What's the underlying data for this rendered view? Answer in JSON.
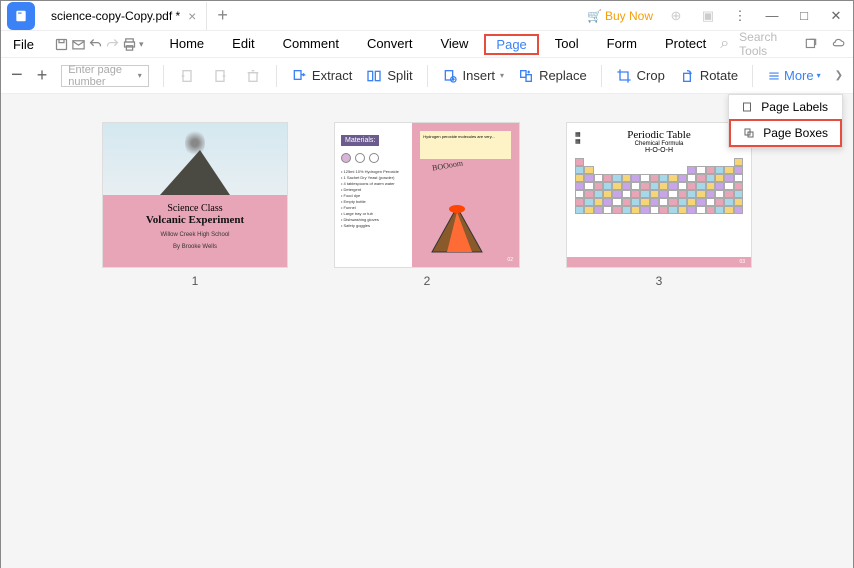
{
  "titlebar": {
    "tab_name": "science-copy-Copy.pdf *",
    "buy_now": "Buy Now"
  },
  "menubar": {
    "file": "File",
    "items": [
      "Home",
      "Edit",
      "Comment",
      "Convert",
      "View",
      "Page",
      "Tool",
      "Form",
      "Protect"
    ],
    "active_index": 5,
    "search_placeholder": "Search Tools"
  },
  "toolbar": {
    "page_input_placeholder": "Enter page number",
    "extract": "Extract",
    "split": "Split",
    "insert": "Insert",
    "replace": "Replace",
    "crop": "Crop",
    "rotate": "Rotate",
    "more": "More"
  },
  "dropdown": {
    "labels": "Page Labels",
    "boxes": "Page Boxes"
  },
  "thumbs": {
    "t1": {
      "title1": "Science Class",
      "title2": "Volcanic Experiment",
      "sub1": "Willow Creek High School",
      "sub2": "By Brooke Wells",
      "num": "1"
    },
    "t2": {
      "materials": "Materials:",
      "boom": "BOOoom",
      "list": "• 125ml 10% Hydrogen Peroxide\n• 1 Sachet Dry Yeast (powder)\n• 4 tablespoons of warm water\n• Detergent\n• Food dye\n• Empty bottle\n• Funnel\n• Large tray or tub\n• Dishwashing gloves\n• Safety goggles",
      "num": "2"
    },
    "t3": {
      "title": "Periodic Table",
      "sub": "Chemical Formula",
      "formula": "H-O-O-H",
      "num": "3"
    }
  }
}
